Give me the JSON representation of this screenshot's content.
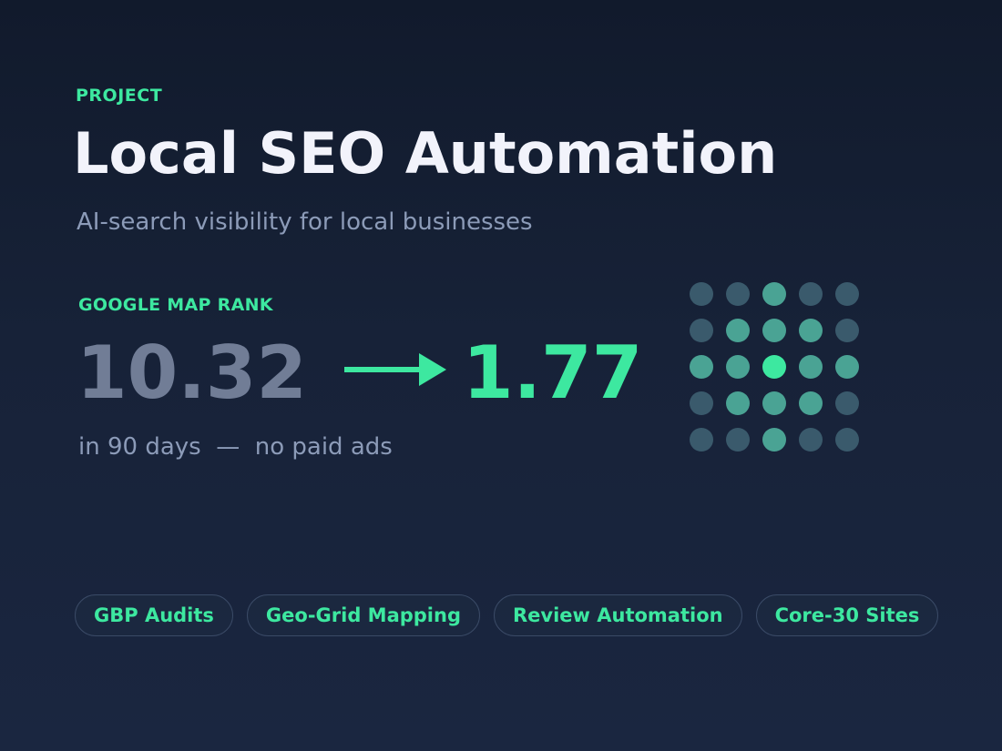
{
  "header": {
    "eyebrow": "PROJECT",
    "title": "Local SEO Automation",
    "subtitle": "AI-search visibility for local businesses"
  },
  "metric": {
    "label": "GOOGLE MAP RANK",
    "before": "10.32",
    "after": "1.77",
    "period": "in 90 days",
    "separator": "—",
    "note": "no paid ads"
  },
  "colors": {
    "accent": "#3de8a0",
    "muted_value": "#717d96",
    "dot_dim": "#3a5a6c",
    "dot_mid": "#4aa394",
    "dot_bright": "#3de8a0"
  },
  "icons": {
    "arrow": "arrow-right-icon",
    "grid": "geo-grid-icon"
  },
  "geo_grid": [
    [
      "dim",
      "dim",
      "mid",
      "dim",
      "dim"
    ],
    [
      "dim",
      "mid",
      "mid",
      "mid",
      "dim"
    ],
    [
      "mid",
      "mid",
      "bright",
      "mid",
      "mid"
    ],
    [
      "dim",
      "mid",
      "mid",
      "mid",
      "dim"
    ],
    [
      "dim",
      "dim",
      "mid",
      "dim",
      "dim"
    ]
  ],
  "tags": [
    {
      "label": "GBP Audits"
    },
    {
      "label": "Geo-Grid Mapping"
    },
    {
      "label": "Review Automation"
    },
    {
      "label": "Core-30 Sites"
    }
  ]
}
